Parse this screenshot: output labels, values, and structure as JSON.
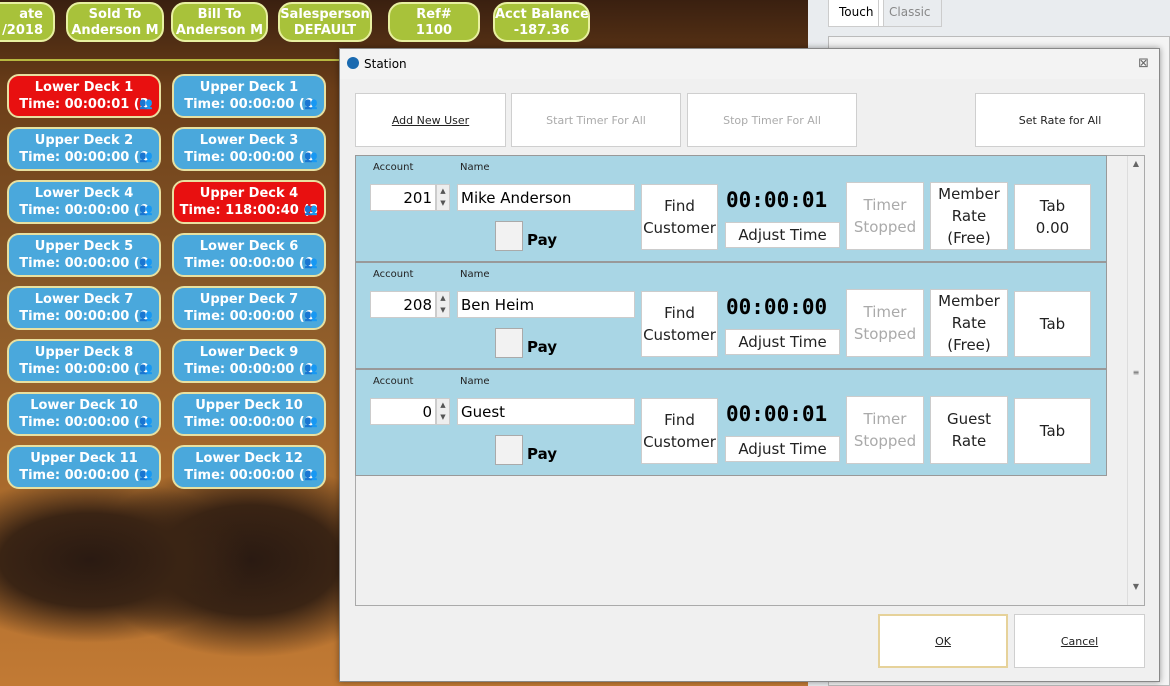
{
  "header_pills": [
    {
      "label": "ate",
      "value": "/2018"
    },
    {
      "label": "Sold To",
      "value": "Anderson M"
    },
    {
      "label": "Bill To",
      "value": "Anderson M"
    },
    {
      "label": "Salesperson",
      "value": "DEFAULT"
    },
    {
      "label": "Ref#",
      "value": "1100"
    },
    {
      "label": "Acct Balance",
      "value": "-187.36"
    }
  ],
  "decks": [
    {
      "name": "Lower Deck 1",
      "time": "Time: 00:00:01 (3",
      "status": "active",
      "color": "#e81010"
    },
    {
      "name": "Upper Deck 1",
      "time": "Time: 00:00:00 (0",
      "status": "idle",
      "color": "#4aa8dc"
    },
    {
      "name": "Upper Deck 2",
      "time": "Time: 00:00:00 (0",
      "status": "idle"
    },
    {
      "name": "Lower Deck 3",
      "time": "Time: 00:00:00 (0",
      "status": "idle"
    },
    {
      "name": "Lower Deck 4",
      "time": "Time: 00:00:00 (0",
      "status": "idle"
    },
    {
      "name": "Upper Deck 4",
      "time": "Time: 118:00:40 (3",
      "status": "active"
    },
    {
      "name": "Upper Deck 5",
      "time": "Time: 00:00:00 (0",
      "status": "idle"
    },
    {
      "name": "Lower Deck 6",
      "time": "Time: 00:00:00 (0",
      "status": "idle"
    },
    {
      "name": "Lower Deck 7",
      "time": "Time: 00:00:00 (0",
      "status": "idle"
    },
    {
      "name": "Upper Deck 7",
      "time": "Time: 00:00:00 (0",
      "status": "idle"
    },
    {
      "name": "Upper Deck 8",
      "time": "Time: 00:00:00 (0",
      "status": "idle"
    },
    {
      "name": "Lower Deck 9",
      "time": "Time: 00:00:00 (0",
      "status": "idle"
    },
    {
      "name": "Lower Deck 10",
      "time": "Time: 00:00:00 (0",
      "status": "idle"
    },
    {
      "name": "Upper Deck 10",
      "time": "Time: 00:00:00 (0",
      "status": "idle"
    },
    {
      "name": "Upper Deck 11",
      "time": "Time: 00:00:00 (0",
      "status": "idle"
    },
    {
      "name": "Lower Deck 12",
      "time": "Time: 00:00:00 (0",
      "status": "idle"
    }
  ],
  "right_panel": {
    "tabs": [
      "Touch",
      "Classic"
    ],
    "active_tab": "Touch"
  },
  "dialog": {
    "title": "Station",
    "toolbar": {
      "add_user": "Add New User",
      "start_all": "Start Timer For All",
      "stop_all": "Stop Timer For All",
      "set_rate": "Set Rate for All"
    },
    "col_account": "Account",
    "col_name": "Name",
    "rows": [
      {
        "account": "201",
        "name": "Mike Anderson",
        "pay": "Pay",
        "find": "Find Customer",
        "time": "00:00:01",
        "adjust": "Adjust  Time",
        "timer": "Timer Stopped",
        "rate": "Member Rate (Free)",
        "tab": "Tab",
        "tab_amount": "0.00"
      },
      {
        "account": "208",
        "name": "Ben Heim",
        "pay": "Pay",
        "find": "Find Customer",
        "time": "00:00:00",
        "adjust": "Adjust  Time",
        "timer": "Timer Stopped",
        "rate": "Member Rate (Free)",
        "tab": "Tab",
        "tab_amount": ""
      },
      {
        "account": "0",
        "name": "Guest",
        "pay": "Pay",
        "find": "Find Customer",
        "time": "00:00:01",
        "adjust": "Adjust  Time",
        "timer": "Timer Stopped",
        "rate": "Guest Rate",
        "tab": "Tab",
        "tab_amount": ""
      }
    ],
    "ok": "OK",
    "cancel": "Cancel"
  }
}
